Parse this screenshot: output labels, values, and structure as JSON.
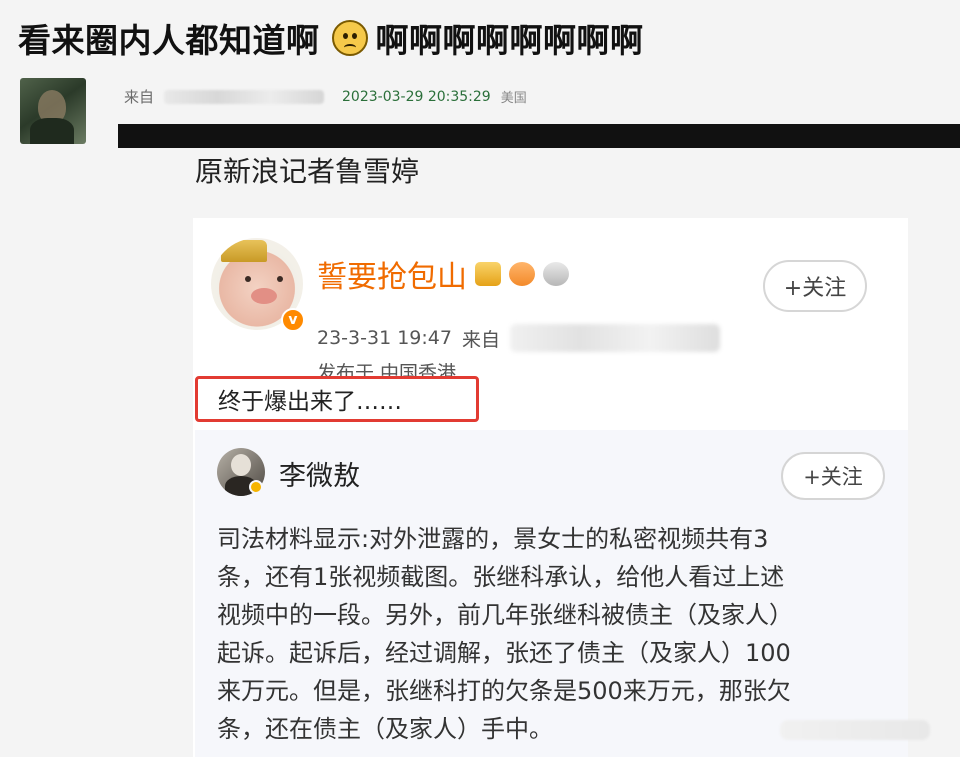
{
  "headline": {
    "text_before": "看来圈内人都知道啊",
    "emoji": "confused-face-icon",
    "text_after": "啊啊啊啊啊啊啊啊"
  },
  "comment_header": {
    "from_prefix": "来自",
    "timestamp": "2023-03-29 20:35:29",
    "region": "美国"
  },
  "reporter_line": "原新浪记者鲁雪婷",
  "weibo_post": {
    "username": "誓要抢包山",
    "timestamp": "23-3-31 19:47",
    "source_prefix": "来自",
    "location": "发布于 中国香港",
    "follow_label": "+关注",
    "text": "终于爆出来了……"
  },
  "nested_post": {
    "username": "李微敖",
    "follow_label": "+关注",
    "lines": [
      "司法材料显示:对外泄露的，景女士的私密视频共有3",
      "条，还有1张视频截图。张继科承认，给他人看过上述",
      "视频中的一段。另外，前几年张继科被债主（及家人）",
      "起诉。起诉后，经过调解，张还了债主（及家人）100",
      "来万元。但是，张继科打的欠条是500来万元，那张欠",
      "条，还在债主（及家人）手中。"
    ]
  },
  "colors": {
    "username_orange": "#f06b00",
    "timestamp_green": "#2b6f3a",
    "highlight_red": "#e23b32"
  }
}
